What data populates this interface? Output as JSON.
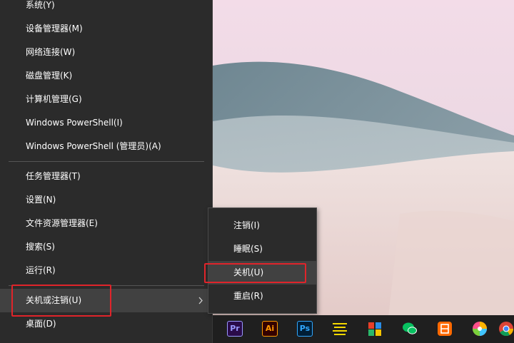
{
  "menu": {
    "items": [
      {
        "label": "系统(Y)"
      },
      {
        "label": "设备管理器(M)"
      },
      {
        "label": "网络连接(W)"
      },
      {
        "label": "磁盘管理(K)"
      },
      {
        "label": "计算机管理(G)"
      },
      {
        "label": "Windows PowerShell(I)"
      },
      {
        "label": "Windows PowerShell (管理员)(A)"
      },
      {
        "label": "任务管理器(T)"
      },
      {
        "label": "设置(N)"
      },
      {
        "label": "文件资源管理器(E)"
      },
      {
        "label": "搜索(S)"
      },
      {
        "label": "运行(R)"
      },
      {
        "label": "关机或注销(U)"
      },
      {
        "label": "桌面(D)"
      }
    ]
  },
  "submenu": {
    "items": [
      {
        "label": "注销(I)"
      },
      {
        "label": "睡眠(S)"
      },
      {
        "label": "关机(U)"
      },
      {
        "label": "重启(R)"
      }
    ]
  },
  "taskbar": {
    "apps": [
      {
        "name": "premiere-icon",
        "text": "Pr",
        "color": "#9999ff"
      },
      {
        "name": "illustrator-icon",
        "text": "Ai",
        "color": "#ff9a00"
      },
      {
        "name": "photoshop-icon",
        "text": "Ps",
        "color": "#31a8ff"
      },
      {
        "name": "notes-icon",
        "text": "",
        "color": "#f5d800"
      },
      {
        "name": "multicolor-app-icon",
        "text": "",
        "color": "#e8402a"
      },
      {
        "name": "wechat-icon",
        "text": "",
        "color": "#07c160"
      },
      {
        "name": "office-app-icon",
        "text": "",
        "color": "#ff6a00"
      },
      {
        "name": "pinwheel-app-icon",
        "text": "",
        "color": "#ff4f8b"
      },
      {
        "name": "chrome-icon",
        "text": "",
        "color": "#4285f4"
      }
    ]
  },
  "colors": {
    "menu_bg": "#2b2b2b",
    "hover_bg": "#414141",
    "highlight_red": "#e0242a"
  }
}
